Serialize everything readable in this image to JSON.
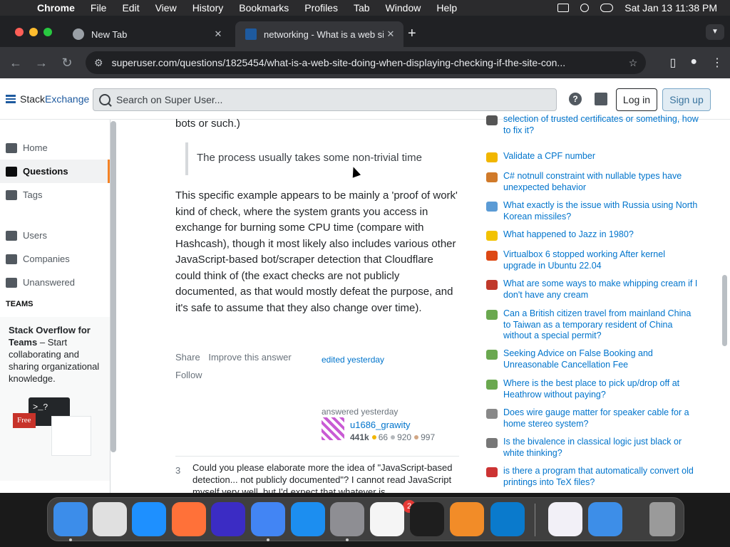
{
  "menubar": {
    "apple": "",
    "app": "Chrome",
    "items": [
      "File",
      "Edit",
      "View",
      "History",
      "Bookmarks",
      "Profiles",
      "Tab",
      "Window",
      "Help"
    ],
    "datetime": "Sat Jan 13  11:38 PM"
  },
  "tabs": [
    {
      "title": "New Tab",
      "close": "✕"
    },
    {
      "title": "networking - What is a web si",
      "close": "✕"
    }
  ],
  "newtab": "+",
  "toolbar": {
    "back": "←",
    "forward": "→",
    "reload": "↻",
    "url": "superuser.com/questions/1825454/what-is-a-web-site-doing-when-displaying-checking-if-the-site-con...",
    "star": "☆"
  },
  "site": {
    "logo_prefix": "Stack",
    "logo_suffix": "Exchange",
    "search_placeholder": "Search on Super User...",
    "help_icon": "?",
    "login": "Log in",
    "signup": "Sign up"
  },
  "leftnav": {
    "items": [
      "Home",
      "Questions",
      "Tags",
      "Users",
      "Companies",
      "Unanswered"
    ],
    "teams_label": "TEAMS",
    "teams_title": "Stack Overflow for Teams",
    "teams_desc": " – Start collaborating and sharing organizational knowledge.",
    "free_badge": "Free",
    "terminal_text": ">_?"
  },
  "answer": {
    "partial_line": "bots or such.)",
    "quote": "The process usually takes some non-trivial time",
    "paragraph": "This specific example appears to be mainly a 'proof of work' kind of check, where the system grants you access in exchange for burning some CPU time (compare with Hashcash), though it most likely also includes various other JavaScript-based bot/scraper detection that Cloudflare could think of (the exact checks are not publicly documented, as that would mostly defeat the purpose, and it's safe to assume that they also change over time).",
    "share": "Share",
    "improve": "Improve this answer",
    "follow": "Follow",
    "edited": "edited yesterday",
    "answered": "answered yesterday",
    "user": "u1686_grawity",
    "reputation": "441k",
    "gold": "66",
    "silver": "920",
    "bronze": "997",
    "badge_colors": {
      "gold": "#f1b600",
      "silver": "#b4b8bc",
      "bronze": "#d1a684"
    }
  },
  "comment": {
    "score": "3",
    "text": "Could you please elaborate more the idea of \"JavaScript-based detection... not publicly documented\"? I cannot read JavaScript myself very well, but I'd expect that whatever is"
  },
  "hot_questions": [
    {
      "text": "selection of trusted certificates or something, how to fix it?",
      "icon_color": "#555555"
    },
    {
      "text": "Validate a CPF number",
      "icon_color": "#f1b600"
    },
    {
      "text": "C# notnull constraint with nullable types have unexpected behavior",
      "icon_color": "#d07a2a"
    },
    {
      "text": "What exactly is the issue with Russia using North Korean missiles?",
      "icon_color": "#5b9bd5"
    },
    {
      "text": "What happened to Jazz in 1980?",
      "icon_color": "#f2c200"
    },
    {
      "text": "Virtualbox 6 stopped working After kernel upgrade in Ubuntu 22.04",
      "icon_color": "#dd4814"
    },
    {
      "text": "What are some ways to make whipping cream if I don't have any cream",
      "icon_color": "#c0392b"
    },
    {
      "text": "Can a British citizen travel from mainland China to Taiwan as a temporary resident of China without a special permit?",
      "icon_color": "#6aa84f"
    },
    {
      "text": "Seeking Advice on False Booking and Unreasonable Cancellation Fee",
      "icon_color": "#6aa84f"
    },
    {
      "text": "Where is the best place to pick up/drop off at Heathrow without paying?",
      "icon_color": "#6aa84f"
    },
    {
      "text": "Does wire gauge matter for speaker cable for a home stereo system?",
      "icon_color": "#888888"
    },
    {
      "text": "Is the bivalence in classical logic just black or white thinking?",
      "icon_color": "#777777"
    },
    {
      "text": "is there a program that automatically convert old printings into TeX files?",
      "icon_color": "#cc3333"
    }
  ],
  "dock": {
    "apps": [
      {
        "name": "finder",
        "color": "#3c8dea"
      },
      {
        "name": "launchpad",
        "color": "#e0e0e0"
      },
      {
        "name": "safari",
        "color": "#1e90ff"
      },
      {
        "name": "firefox",
        "color": "#ff7139"
      },
      {
        "name": "fenix",
        "color": "#3b2cc4"
      },
      {
        "name": "chrome",
        "color": "#4285f4"
      },
      {
        "name": "app-store",
        "color": "#1c8ef0"
      },
      {
        "name": "system-settings",
        "color": "#8e8e93"
      },
      {
        "name": "textedit",
        "color": "#f5f5f5"
      },
      {
        "name": "terminal",
        "color": "#1e1e1e"
      },
      {
        "name": "garageband",
        "color": "#f28c28"
      },
      {
        "name": "vscode",
        "color": "#0a7acc"
      },
      {
        "name": "visual-studio",
        "color": "#f2f0f7"
      },
      {
        "name": "weather",
        "color": "#3d8ee8"
      },
      {
        "name": "trash",
        "color": "#9a9a9a"
      }
    ],
    "settings_badge": "2"
  }
}
